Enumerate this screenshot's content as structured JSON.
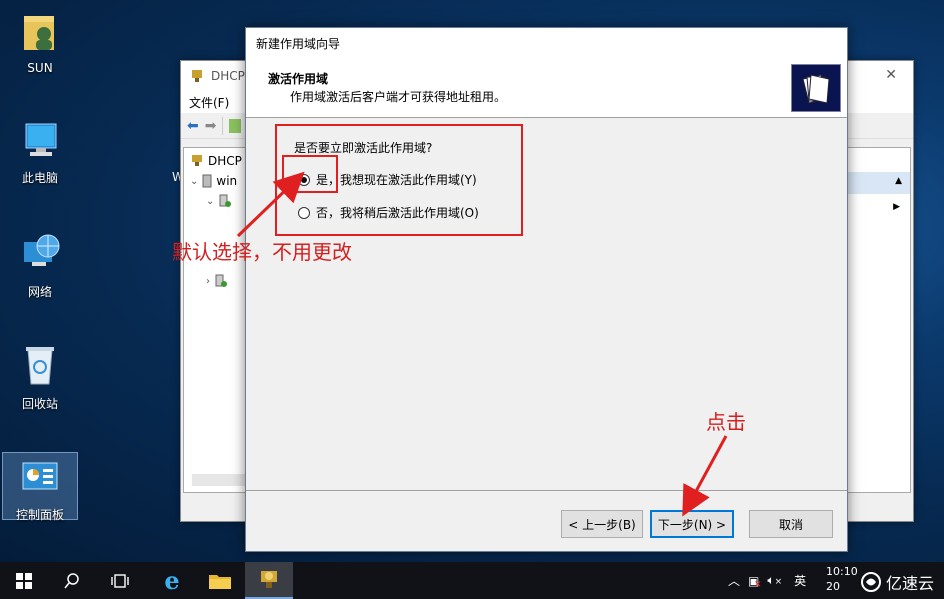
{
  "desktop": {
    "icons": [
      {
        "label": "SUN"
      },
      {
        "label": "此电脑"
      },
      {
        "label": "网络"
      },
      {
        "label": "回收站"
      },
      {
        "label": "控制面板"
      }
    ]
  },
  "dhcp_window": {
    "title": "DHCP",
    "menu_file": "文件(F)",
    "tree_root": "DHCP",
    "tree_server": "win",
    "left_text_w": "W"
  },
  "wizard": {
    "window_title": "新建作用域向导",
    "header_title": "激活作用域",
    "header_subtitle": "作用域激活后客户端才可获得地址租用。",
    "question": "是否要立即激活此作用域?",
    "options": [
      {
        "label": "是，我想现在激活此作用域(Y)",
        "selected": true
      },
      {
        "label": "否，我将稍后激活此作用域(O)",
        "selected": false
      }
    ],
    "buttons": {
      "back": "< 上一步(B)",
      "next": "下一步(N) >",
      "cancel": "取消"
    }
  },
  "annotations": {
    "default_note": "默认选择，不用更改",
    "click_note": "点击",
    "color": "#e02020"
  },
  "taskbar": {
    "ime": "英",
    "time": "10:10",
    "date_partial": "20"
  },
  "watermark": {
    "text": "亿速云"
  }
}
